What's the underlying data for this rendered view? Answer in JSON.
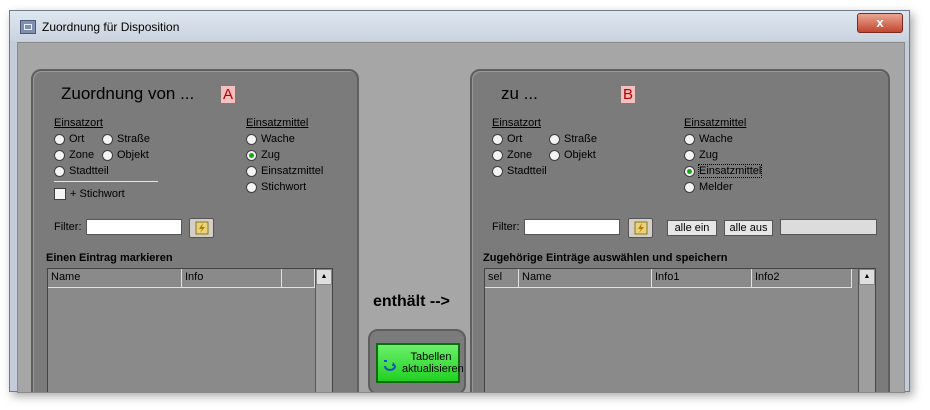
{
  "window": {
    "title": "Zuordnung für Disposition",
    "close_symbol": "x"
  },
  "left": {
    "title": "Zuordnung von ...",
    "badge": "A",
    "einsatzort_label": "Einsatzort",
    "einsatzort_options": [
      "Ort",
      "Straße",
      "Zone",
      "Objekt",
      "Stadtteil"
    ],
    "stichwort_label": "+ Stichwort",
    "einsatzmittel_label": "Einsatzmittel",
    "einsatzmittel_options": [
      "Wache",
      "Zug",
      "Einsatzmittel",
      "Stichwort"
    ],
    "einsatzmittel_selected": "Zug",
    "filter_label": "Filter:",
    "filter_value": "",
    "list_title": "Einen Eintrag markieren",
    "columns": [
      "Name",
      "Info"
    ]
  },
  "right": {
    "title": "zu ...",
    "badge": "B",
    "einsatzort_label": "Einsatzort",
    "einsatzort_options": [
      "Ort",
      "Straße",
      "Zone",
      "Objekt",
      "Stadtteil"
    ],
    "einsatzmittel_label": "Einsatzmittel",
    "einsatzmittel_options": [
      "Wache",
      "Zug",
      "Einsatzmittel",
      "Melder"
    ],
    "einsatzmittel_selected": "Einsatzmittel",
    "filter_label": "Filter:",
    "filter_value": "",
    "select_all_label": "alle ein",
    "deselect_all_label": "alle aus",
    "list_title": "Zugehörige Einträge auswählen und speichern",
    "columns": [
      "sel",
      "Name",
      "Info1",
      "Info2"
    ]
  },
  "relation_label": "enthält -->",
  "refresh_button_label": "Tabellen aktualisieren",
  "icons": {
    "filter_button": "lightning-icon",
    "refresh": "refresh-arrows-icon",
    "scroll_up": "arrow-up-icon"
  },
  "colors": {
    "panel": "#7b7b7b",
    "background": "#a6a6a6",
    "refresh_button": "#33dd33",
    "selected_radio": "#1aa61a",
    "badge_bg": "#f3bfbf"
  }
}
